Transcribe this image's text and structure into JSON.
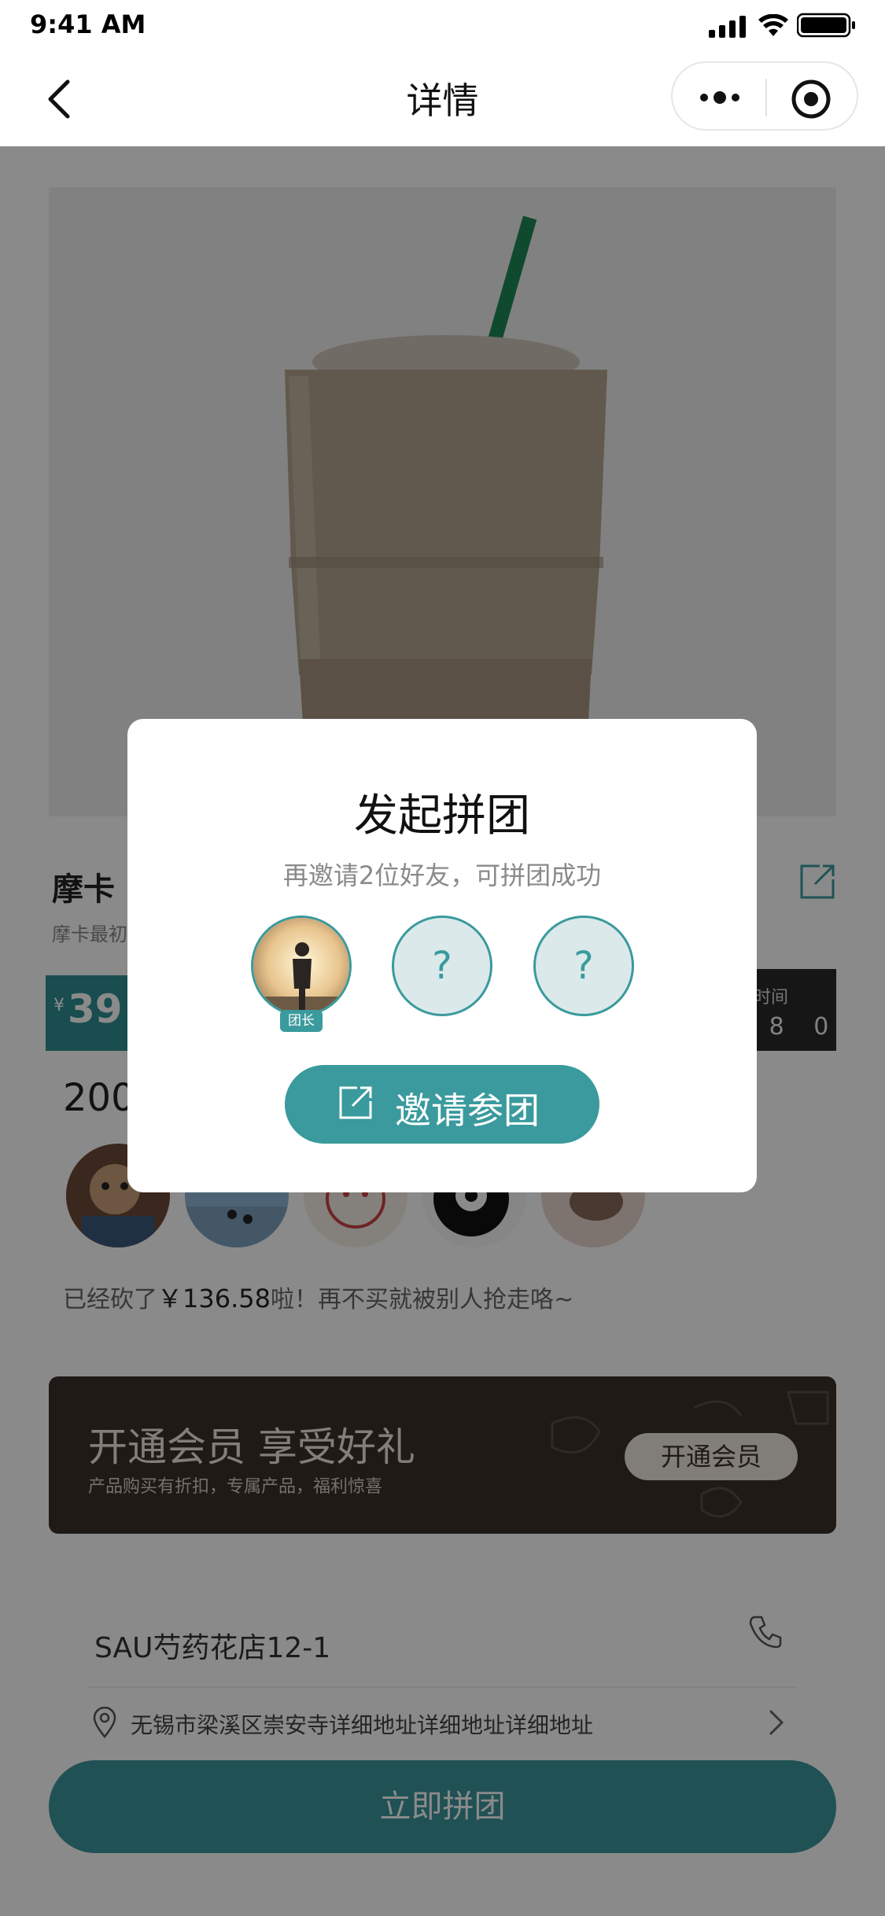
{
  "status_bar": {
    "time": "9:41 AM"
  },
  "nav": {
    "title": "详情"
  },
  "product": {
    "title": "摩卡",
    "desc": "摩卡最初",
    "price_symbol": "¥",
    "price": "39",
    "countdown_label": "时间",
    "countdown_value": ": 8 0",
    "sold": "200",
    "cut_prefix": "已经砍了",
    "cut_amount": "￥136.58",
    "cut_suffix": "啦！再不买就被别人抢走咯~"
  },
  "member": {
    "title": "开通会员 享受好礼",
    "subtitle": "产品购买有折扣，专属产品，福利惊喜",
    "button": "开通会员"
  },
  "store": {
    "name": "SAU芍药花店12-1",
    "address": "无锡市梁溪区崇安寺详细地址详细地址详细地址"
  },
  "bottom": {
    "join_label": "立即拼团"
  },
  "modal": {
    "title": "发起拼团",
    "subtitle": "再邀请2位好友，可拼团成功",
    "leader_badge": "团长",
    "slot_placeholder": "?",
    "invite_label": "邀请参团"
  },
  "colors": {
    "accent": "#3a9a9d",
    "member_bg": "#3b302c"
  }
}
